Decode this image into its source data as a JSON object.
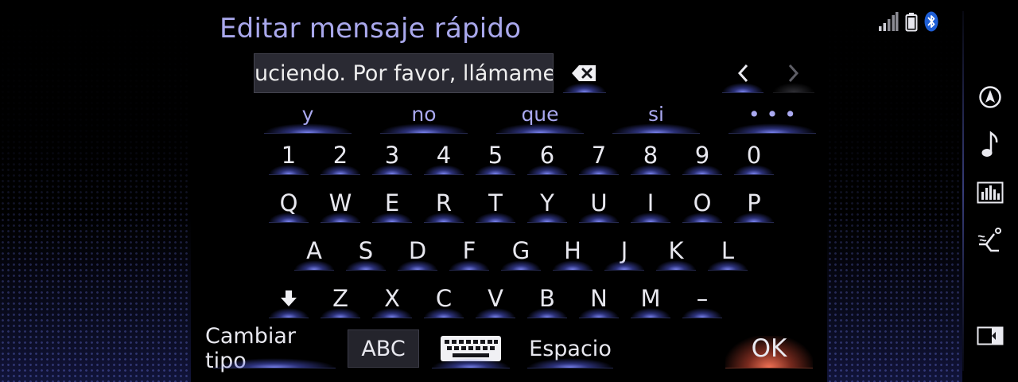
{
  "title": "Editar mensaje rápido",
  "input": {
    "value": "uciendo. Por favor, llámame."
  },
  "suggestions": [
    "y",
    "no",
    "que",
    "si",
    "• • •"
  ],
  "rows": {
    "numbers": [
      "1",
      "2",
      "3",
      "4",
      "5",
      "6",
      "7",
      "8",
      "9",
      "0"
    ],
    "qwerty": [
      "Q",
      "W",
      "E",
      "R",
      "T",
      "Y",
      "U",
      "I",
      "O",
      "P"
    ],
    "home": [
      "A",
      "S",
      "D",
      "F",
      "G",
      "H",
      "J",
      "K",
      "L"
    ],
    "bottom": [
      "Z",
      "X",
      "C",
      "V",
      "B",
      "N",
      "M",
      "–"
    ]
  },
  "footer": {
    "change_type": "Cambiar tipo",
    "abc": "ABC",
    "space": "Espacio",
    "ok": "OK"
  },
  "icons": {
    "backspace": "backspace-icon",
    "left": "chevron-left-icon",
    "right": "chevron-right-icon",
    "shift": "shift-down-arrow-icon",
    "keyboard": "keyboard-icon",
    "signal": "signal-bars-icon",
    "battery": "battery-icon",
    "bluetooth": "bluetooth-icon",
    "nav": "navigation-icon",
    "music": "music-note-icon",
    "equalizer": "equalizer-icon",
    "seat": "seat-climate-icon",
    "screen": "screen-split-icon"
  },
  "colors": {
    "accent": "#aaa9f0",
    "glow": "#8088ff",
    "ok_glow": "#ff7a5a"
  }
}
